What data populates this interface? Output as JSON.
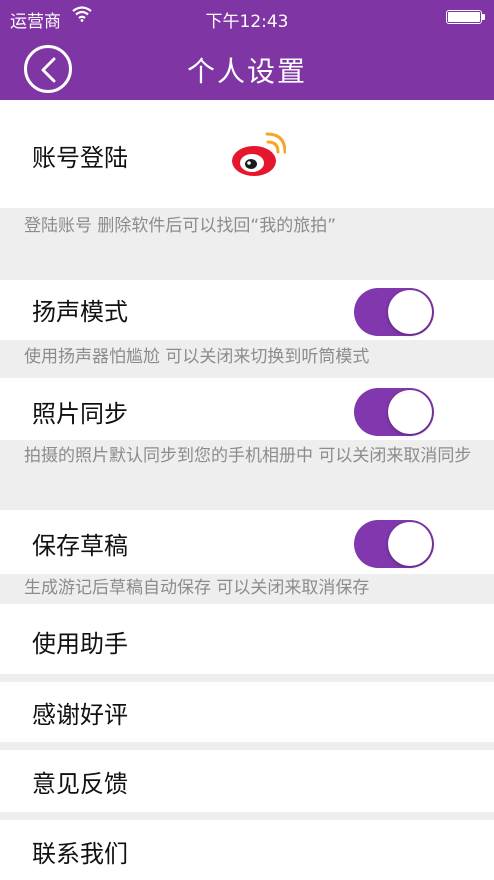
{
  "status_bar": {
    "carrier": "运营商",
    "time": "下午12:43"
  },
  "header": {
    "title": "个人设置"
  },
  "account": {
    "label": "账号登陆",
    "note": "登陆账号 删除软件后可以找回“我的旅拍”"
  },
  "speaker": {
    "label": "扬声模式",
    "note": "使用扬声器怕尴尬 可以关闭来切换到听筒模式",
    "enabled": true
  },
  "photo_sync": {
    "label": "照片同步",
    "note": "拍摄的照片默认同步到您的手机相册中 可以关闭来取消同步",
    "enabled": true
  },
  "drafts": {
    "label": "保存草稿",
    "note": "生成游记后草稿自动保存 可以关闭来取消保存",
    "enabled": true
  },
  "menu": [
    {
      "label": "使用助手"
    },
    {
      "label": "感谢好评"
    },
    {
      "label": "意见反馈"
    },
    {
      "label": "联系我们"
    }
  ],
  "colors": {
    "accent": "#7f35a3",
    "toggle_on": "#8137ad",
    "separator": "#eeeeee",
    "note_text": "#8c8c8c"
  }
}
